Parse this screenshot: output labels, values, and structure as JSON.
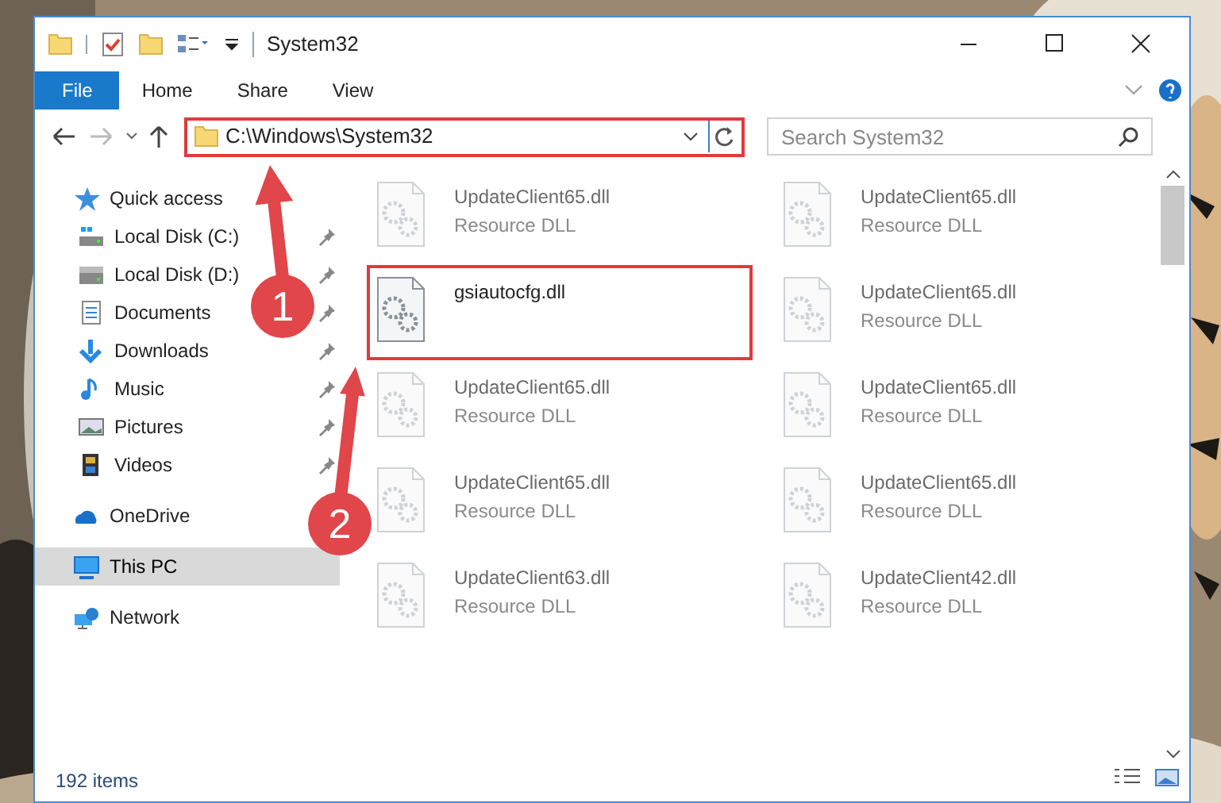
{
  "window": {
    "title": "System32"
  },
  "ribbon_tabs": [
    {
      "label": "File",
      "selected": true
    },
    {
      "label": "Home",
      "selected": false
    },
    {
      "label": "Share",
      "selected": false
    },
    {
      "label": "View",
      "selected": false
    }
  ],
  "address": {
    "value": "C:\\Windows\\System32"
  },
  "search": {
    "placeholder": "Search System32"
  },
  "nav": [
    {
      "label": "Quick access",
      "selected": false,
      "children": [
        {
          "label": "Local Disk (C:)",
          "pinned": true,
          "selected": false
        },
        {
          "label": "Local Disk (D:)",
          "pinned": true,
          "selected": false
        },
        {
          "label": "Documents",
          "pinned": true,
          "selected": false
        },
        {
          "label": "Downloads",
          "pinned": true,
          "selected": false
        },
        {
          "label": "Music",
          "pinned": true,
          "selected": false
        },
        {
          "label": "Pictures",
          "pinned": true,
          "selected": false
        },
        {
          "label": "Videos",
          "pinned": true,
          "selected": false
        }
      ]
    },
    {
      "label": "OneDrive",
      "selected": false
    },
    {
      "label": "This PC",
      "selected": true
    },
    {
      "label": "Network",
      "selected": false
    }
  ],
  "files": [
    {
      "name": "UpdateClient65.dll",
      "type": "Resource DLL",
      "blurred": true,
      "highlighted": false
    },
    {
      "name": "UpdateClient65.dll",
      "type": "Resource DLL",
      "blurred": true,
      "highlighted": false
    },
    {
      "name": "gsiautocfg.dll",
      "blurred": false,
      "highlighted": true
    },
    {
      "name": "UpdateClient65.dll",
      "type": "Resource DLL",
      "blurred": true,
      "highlighted": false
    },
    {
      "name": "UpdateClient65.dll",
      "type": "Resource DLL",
      "blurred": true,
      "highlighted": false
    },
    {
      "name": "UpdateClient65.dll",
      "type": "Resource DLL",
      "blurred": true,
      "highlighted": false
    },
    {
      "name": "UpdateClient65.dll",
      "type": "Resource DLL",
      "blurred": true,
      "highlighted": false
    },
    {
      "name": "UpdateClient65.dll",
      "type": "Resource DLL",
      "blurred": true,
      "highlighted": false
    },
    {
      "name": "UpdateClient63.dll",
      "type": "Resource DLL",
      "blurred": true,
      "highlighted": false
    },
    {
      "name": "UpdateClient42.dll",
      "type": "Resource DLL",
      "blurred": true,
      "highlighted": false
    }
  ],
  "status_bar": {
    "count": "192 items"
  },
  "annotations": [
    {
      "number": "1"
    },
    {
      "number": "2"
    }
  ]
}
